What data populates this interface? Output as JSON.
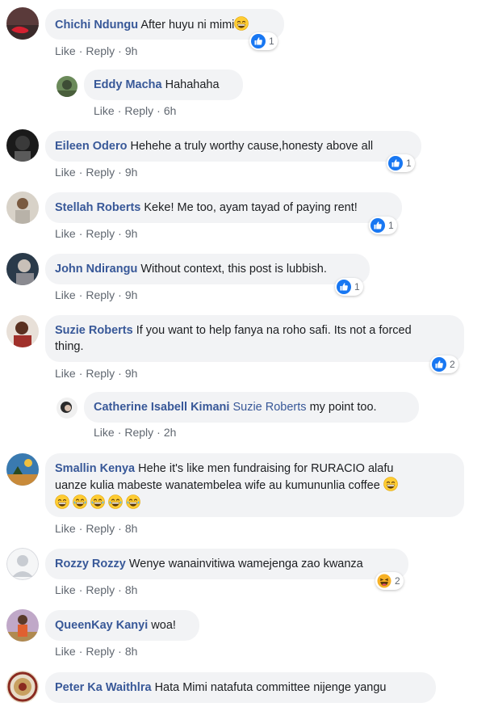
{
  "actions": {
    "like": "Like",
    "reply": "Reply",
    "sep": "·"
  },
  "icons": {
    "like_reaction": "thumbs-up-icon",
    "haha_reaction": "laughing-emoji-icon",
    "grin_emoji": "grinning-emoji-icon"
  },
  "colors": {
    "author": "#385898",
    "like_blue": "#1877f2",
    "bubble": "#f2f3f5"
  },
  "comments": [
    {
      "author": "Chichi Ndungu",
      "text": "After huyu ni mimi",
      "time": "9h",
      "reactions": "1"
    },
    {
      "author": "Eddy Macha",
      "text": "Hahahaha",
      "time": "6h"
    },
    {
      "author": "Eileen Odero",
      "text": "Hehehe a truly worthy cause,honesty above all",
      "time": "9h",
      "reactions": "1"
    },
    {
      "author": "Stellah Roberts",
      "text": "Keke! Me too, ayam tayad of paying rent!",
      "time": "9h",
      "reactions": "1"
    },
    {
      "author": "John Ndirangu",
      "text": "Without context, this post is lubbish.",
      "time": "9h",
      "reactions": "1"
    },
    {
      "author": "Suzie Roberts",
      "text_line1": "If you want to help fanya na roho safi. Its not a forced",
      "text_line2": "thing.",
      "time": "9h",
      "reactions": "2"
    },
    {
      "author": "Catherine Isabell Kimani",
      "mention": "Suzie Roberts",
      "text": "my point too.",
      "time": "2h"
    },
    {
      "author": "Smallin Kenya",
      "text_line1": "Hehe it's like men fundraising for RURACIO alafu",
      "text_line2": "uanze kulia mabeste wanatembelea wife au kumununlia coffee",
      "time": "8h"
    },
    {
      "author": "Rozzy Rozzy",
      "text": "Wenye wanainvitiwa wamejenga zao kwanza",
      "time": "8h",
      "reactions": "2"
    },
    {
      "author": "QueenKay Kanyi",
      "text": "woa!",
      "time": "8h"
    },
    {
      "author": "Peter Ka Waithlra",
      "text": "Hata Mimi natafuta committee nijenge yangu"
    }
  ]
}
